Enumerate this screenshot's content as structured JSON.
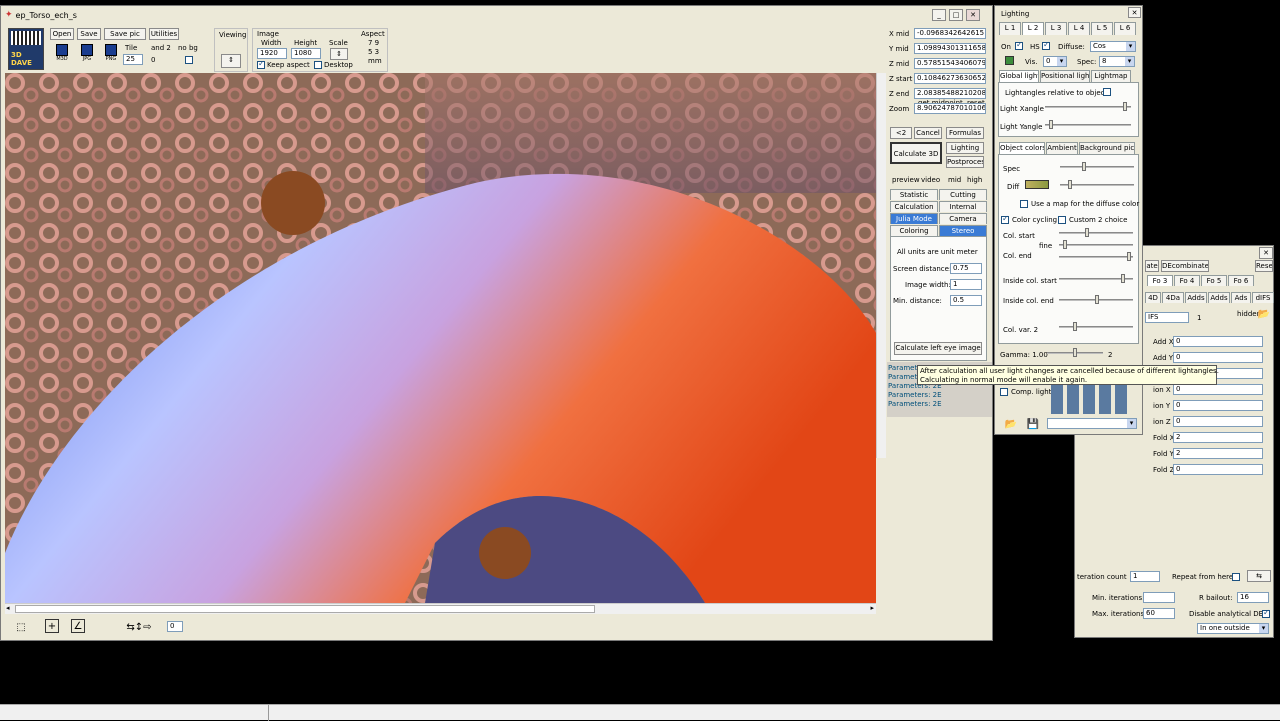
{
  "main_window": {
    "title": "ep_Torso_ech_s",
    "toolbar": {
      "open": "Open",
      "save": "Save",
      "save_pic": "Save pic",
      "utilities": "Utilities",
      "mini_icons": [
        "M3D",
        "JPG",
        "PNG"
      ],
      "tile_label": "Tile",
      "tile_value": "25",
      "tile2_label": "and 2",
      "tile2_value": "0",
      "nobg_label": "no bg",
      "viewing": "Viewing",
      "image_label": "Image",
      "width_label": "Width",
      "width_value": "1920",
      "height_label": "Height",
      "height_value": "1080",
      "scale_label": "Scale",
      "aspect_label": "Aspect",
      "aspect_values": [
        "7 9",
        "5 3",
        "mm"
      ],
      "keep_aspect": "Keep aspect",
      "desktop": "Desktop",
      "logo_text": "3D DAVE"
    },
    "coords": [
      {
        "label": "X mid",
        "value": "-0.0968342642615"
      },
      {
        "label": "Y mid",
        "value": "1.09894301311658"
      },
      {
        "label": "Z mid",
        "value": "0.578515434060794"
      },
      {
        "label": "Z start",
        "value": "0.10846273630652"
      },
      {
        "label": "Z end",
        "value": "2.08385488210208"
      },
      {
        "label": "Zoom",
        "value": "8.90624787010106"
      }
    ],
    "get_midpoint": "get midpoint",
    "reset": "reset",
    "side_buttons": {
      "k": "<2",
      "cancel": "Cancel",
      "calculate": "Calculate 3D",
      "formulas": "Formulas",
      "lighting": "Lighting",
      "postprocess": "Postprocess",
      "preview": "preview",
      "video": "video",
      "mid": "mid",
      "high": "high"
    },
    "tabs_row1": [
      "Statistic",
      "Cutting"
    ],
    "tabs_row2": [
      "Calculation",
      "Internal"
    ],
    "tabs_row3": [
      "Julia Mode",
      "Camera"
    ],
    "tabs_row4": [
      "Coloring",
      "Stereo"
    ],
    "stereo": {
      "all_units": "All units are unit meter",
      "screen_distance_label": "Screen distance:",
      "screen_distance_value": "0.75",
      "image_width_label": "Image width:",
      "image_width_value": "1",
      "min_distance_label": "Min. distance:",
      "min_distance_value": "0.5",
      "calc_left_eye": "Calculate left eye image"
    },
    "params": [
      "Parameters: 2E",
      "Parameters: 2E",
      "Parameters: 2E",
      "Parameters: 2E",
      "Parameters: 2E"
    ],
    "bottom": {
      "value": "0"
    }
  },
  "lighting": {
    "title": "Lighting",
    "light_tabs": [
      "L 1",
      "L 2",
      "L 3",
      "L 4",
      "L 5",
      "L 6"
    ],
    "on": "On",
    "hs": "HS",
    "diffuse_label": "Diffuse:",
    "diffuse_value": "Cos",
    "vis": "Vis.",
    "vis_value": "0",
    "spec_label": "Spec:",
    "spec_value": "8",
    "sub_tabs": [
      "Global light",
      "Positional light",
      "Lightmap"
    ],
    "relative": "Lightangles relative to object",
    "xangle": "Light Xangle",
    "yangle": "Light Yangle",
    "color_tabs": [
      "Object colors",
      "Ambient",
      "Background pic"
    ],
    "spec": "Spec",
    "diff": "Diff",
    "use_map": "Use a map for the diffuse color",
    "color_cycling": "Color cycling",
    "color_choice": "Custom 2 choice",
    "col_start": "Col. start",
    "fine": "fine",
    "col_end": "Col. end",
    "inside_start": "Inside col. start",
    "inside_end": "Inside col. end",
    "col_var": "Col. var. 2",
    "gamma": "Gamma: 1.00",
    "gamma_right": "2",
    "comp_lights": "Comp. lights",
    "tooltip_line1": "After calculation all user light changes are cancelled because of different lightangles.",
    "tooltip_line2": "Calculating in normal mode will enable it again."
  },
  "formula": {
    "title": "",
    "tabs_top": [
      "ate",
      "DEcombinate",
      "Reset"
    ],
    "tabs_fo": [
      "Fo 3",
      "Fo 4",
      "Fo 5",
      "Fo 6"
    ],
    "tabs_row": [
      "4D",
      "4Da",
      "Adds",
      "Adds",
      "Ads",
      "dIFS"
    ],
    "name_value": "IFS",
    "name_count": "1",
    "hidden": "hidden",
    "fields": [
      {
        "label": "Add X",
        "value": "0"
      },
      {
        "label": "Add Y",
        "value": "0"
      },
      {
        "label": "",
        "value": "0"
      },
      {
        "label": "ion X",
        "value": "0"
      },
      {
        "label": "ion Y",
        "value": "0"
      },
      {
        "label": "ion Z",
        "value": "0"
      },
      {
        "label": "Fold X",
        "value": "2"
      },
      {
        "label": "Fold Y",
        "value": "2"
      },
      {
        "label": "Fold Z",
        "value": "0"
      }
    ],
    "iteration_count_label": "teration count",
    "iteration_count_value": "1",
    "repeat_label": "Repeat from here",
    "min_iter_label": "Min. iterations:",
    "min_iter_value": "",
    "max_iter_label": "Max. iterations:",
    "max_iter_value": "60",
    "rstop_label": "R bailout:",
    "rstop_value": "16",
    "disable_de": "Disable analytical DE",
    "dropdown": "In one outside"
  },
  "colors": {
    "highlight_tab": "#3a7bd5",
    "param_text": "#004f7a"
  }
}
